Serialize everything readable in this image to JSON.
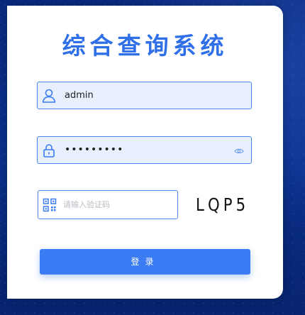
{
  "title": "综合查询系统",
  "username": {
    "value": "admin",
    "icon": "user-icon"
  },
  "password": {
    "value": "•••••••••",
    "icon": "lock-icon",
    "toggle_icon": "eye-icon"
  },
  "captcha": {
    "placeholder": "请输入验证码",
    "icon": "qr-code-icon",
    "code": "LQP5"
  },
  "login_button": {
    "label": "登录"
  },
  "colors": {
    "accent": "#3b7bf3",
    "title": "#2f6fe8",
    "field_bg": "#e8f0fd",
    "background": "#0a2a80"
  }
}
